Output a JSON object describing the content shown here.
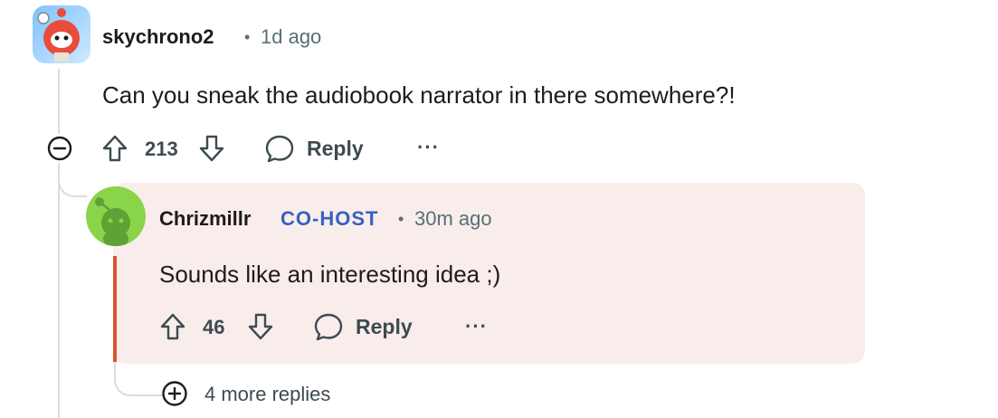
{
  "parent": {
    "username": "skychrono2",
    "separator": "•",
    "time": "1d ago",
    "body": "Can you sneak the audiobook narrator in there somewhere?!",
    "votes": "213",
    "reply_label": "Reply",
    "more_label": "···"
  },
  "reply": {
    "username": "Chrizmillr",
    "flair": "CO-HOST",
    "separator": "•",
    "time": "30m ago",
    "body": "Sounds like an interesting idea ;)",
    "votes": "46",
    "reply_label": "Reply",
    "more_label": "···",
    "accent_color": "#d9562c",
    "card_color": "#f9edeb"
  },
  "more_replies": {
    "label": "4 more replies"
  },
  "icons": {
    "collapse": "collapse-minus-icon",
    "expand": "expand-plus-icon",
    "upvote": "upvote-arrow-icon",
    "downvote": "downvote-arrow-icon",
    "reply": "speech-bubble-icon"
  }
}
